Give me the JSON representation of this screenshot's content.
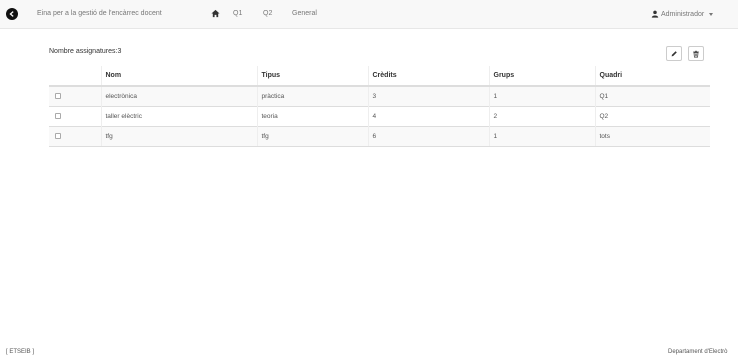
{
  "navbar": {
    "brand": "Eina per a la gestió de l'encàrrec docent",
    "links": [
      "Q1",
      "Q2",
      "General"
    ],
    "user": "Administrador"
  },
  "main": {
    "count_label": "Nombre assignatures:3",
    "table": {
      "headers": [
        "Nom",
        "Tipus",
        "Crèdits",
        "Grups",
        "Quadri"
      ],
      "rows": [
        [
          "electrònica",
          "pràctica",
          "3",
          "1",
          "Q1"
        ],
        [
          "taller elèctric",
          "teoria",
          "4",
          "2",
          "Q2"
        ],
        [
          "tfg",
          "tfg",
          "6",
          "1",
          "tots"
        ]
      ]
    }
  },
  "footer": {
    "left": "[ ETSEIB ]",
    "right": "Departament d'Electrò"
  },
  "icons": {
    "logo": "back-arrow-circle-icon",
    "home": "home-icon",
    "user": "user-icon",
    "edit": "pencil-icon",
    "delete": "trash-icon"
  }
}
